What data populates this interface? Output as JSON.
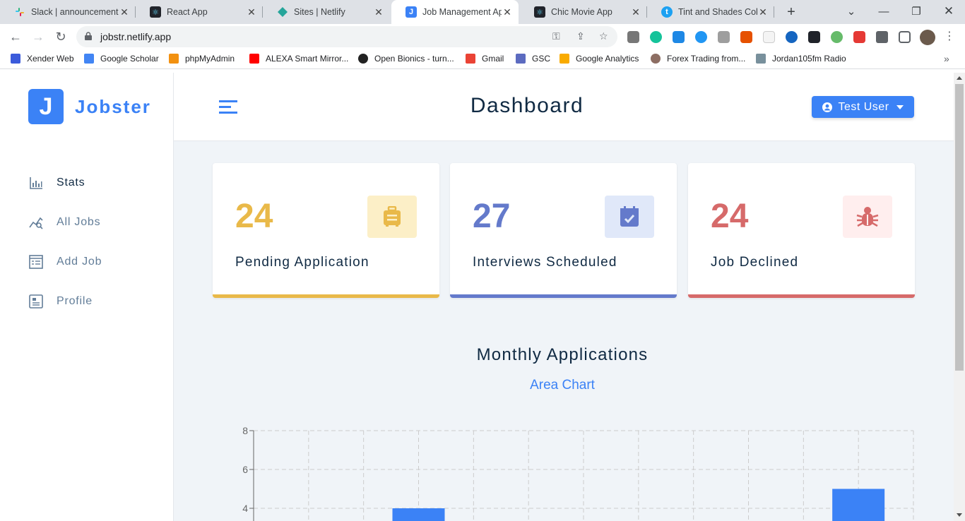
{
  "browser": {
    "tabs": [
      {
        "title": "Slack | announcement",
        "icon": "slack-icon"
      },
      {
        "title": "React App",
        "icon": "react-icon"
      },
      {
        "title": "Sites | Netlify",
        "icon": "netlify-icon"
      },
      {
        "title": "Job Management App",
        "icon": "jobster-icon"
      },
      {
        "title": "Chic Movie App",
        "icon": "react-icon"
      },
      {
        "title": "Tint and Shades Color",
        "icon": "tint-icon"
      }
    ],
    "favicon_letter": "J",
    "url": "jobstr.netlify.app",
    "bookmarks": [
      "Xender Web",
      "Google Scholar",
      "phpMyAdmin",
      "ALEXA Smart Mirror...",
      "Open Bionics - turn...",
      "Gmail",
      "GSC",
      "Google Analytics",
      "Forex Trading from...",
      "Jordan105fm Radio"
    ]
  },
  "app": {
    "logo_letter": "J",
    "logo_text": "Jobster",
    "page_title": "Dashboard",
    "user_label": "Test User",
    "nav": [
      {
        "label": "Stats",
        "icon": "stats-icon"
      },
      {
        "label": "All Jobs",
        "icon": "all-jobs-icon"
      },
      {
        "label": "Add Job",
        "icon": "add-job-icon"
      },
      {
        "label": "Profile",
        "icon": "profile-icon"
      }
    ],
    "stats": [
      {
        "count": "24",
        "label": "Pending Application",
        "color": "#e9b949",
        "bg": "#fcefc7",
        "icon": "suitcase-icon"
      },
      {
        "count": "27",
        "label": "Interviews Scheduled",
        "color": "#647acb",
        "bg": "#e0e8f9",
        "icon": "calendar-check-icon"
      },
      {
        "count": "24",
        "label": "Job Declined",
        "color": "#d66a6a",
        "bg": "#ffeeee",
        "icon": "bug-icon"
      }
    ],
    "chart_title": "Monthly Applications",
    "chart_toggle": "Area Chart"
  },
  "chart_data": {
    "type": "bar",
    "categories": [
      "",
      "",
      "",
      "",
      "",
      ""
    ],
    "values": [
      null,
      4,
      null,
      null,
      null,
      5
    ],
    "yticks": [
      8,
      6,
      4
    ],
    "ylim": [
      0,
      8
    ],
    "grid": true,
    "bar_color": "#3b82f6"
  }
}
